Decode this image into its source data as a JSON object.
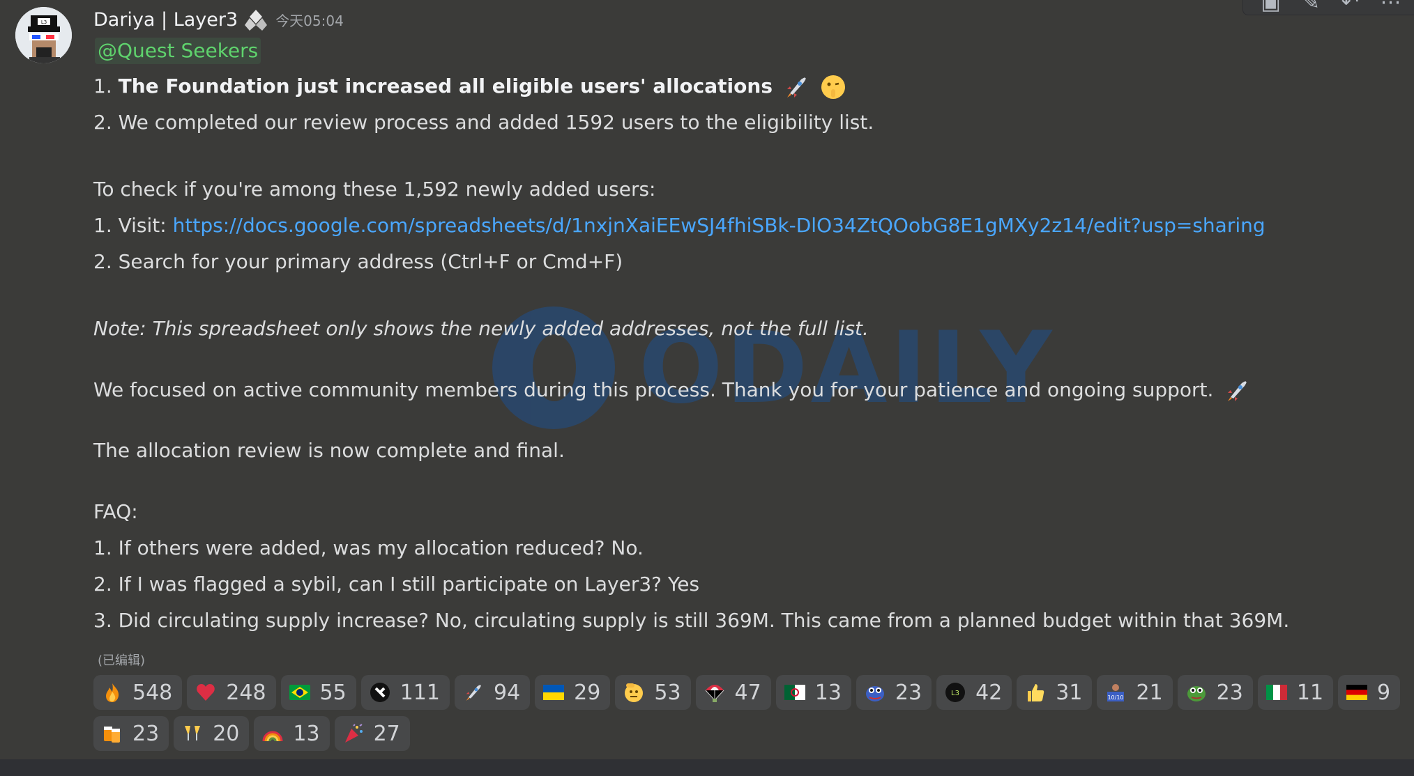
{
  "author": {
    "name": "Dariya | Layer3",
    "timestamp": "今天05:04"
  },
  "mention": "@Quest Seekers",
  "lines": {
    "l1_prefix": "1. ",
    "l1_bold": "The Foundation just increased all eligible users' allocations",
    "l2": "2. We completed our review process and added 1592 users to the eligibility list.",
    "l3": "To check if you're among these 1,592 newly added users:",
    "l4_prefix": "1. Visit: ",
    "l4_link": "https://docs.google.com/spreadsheets/d/1nxjnXaiEEwSJ4fhiSBk-DlO34ZtQOobG8E1gMXy2z14/edit?usp=sharing",
    "l5": "2. Search for your primary address (Ctrl+F or Cmd+F)",
    "l6": "Note: This spreadsheet only shows the newly added addresses, not the full list.",
    "l7": "We focused on active community members during this process. Thank you for your patience and ongoing support.",
    "l8": "The allocation review is now complete and final.",
    "l9": "FAQ:",
    "l10": "1. If others were added, was my allocation reduced? No.",
    "l11": "2. If I was flagged a sybil, can I still participate on Layer3? Yes",
    "l12": "3. Did circulating supply increase? No, circulating supply is still 369M. This came from a planned budget within that 369M."
  },
  "edited_label": "(已编辑)",
  "reactions_row1": [
    {
      "icon": "fire-icon",
      "count": "548"
    },
    {
      "icon": "red-heart-icon",
      "count": "248"
    },
    {
      "icon": "brazil-flag-icon",
      "count": "55"
    },
    {
      "icon": "custom-logo-icon",
      "count": "111"
    },
    {
      "icon": "rocket-icon",
      "count": "94"
    },
    {
      "icon": "ukraine-flag-icon",
      "count": "29"
    },
    {
      "icon": "saluting-face-icon",
      "count": "53"
    },
    {
      "icon": "parachute-icon",
      "count": "47"
    },
    {
      "icon": "algeria-flag-icon",
      "count": "13"
    },
    {
      "icon": "pepe-icon",
      "count": "23"
    },
    {
      "icon": "layer3-logo-icon",
      "count": "42"
    },
    {
      "icon": "thumbs-up-icon",
      "count": "31"
    },
    {
      "icon": "ten-ten-icon",
      "count": "21"
    },
    {
      "icon": "pepe-frog-icon",
      "count": "23"
    },
    {
      "icon": "italy-flag-icon",
      "count": "11"
    },
    {
      "icon": "germany-flag-icon",
      "count": "9"
    }
  ],
  "reactions_row2": [
    {
      "icon": "beer-mugs-icon",
      "count": "23"
    },
    {
      "icon": "champagne-glasses-icon",
      "count": "20"
    },
    {
      "icon": "rainbow-icon",
      "count": "13"
    },
    {
      "icon": "party-popper-icon",
      "count": "27"
    }
  ],
  "watermark": "ODAILY"
}
